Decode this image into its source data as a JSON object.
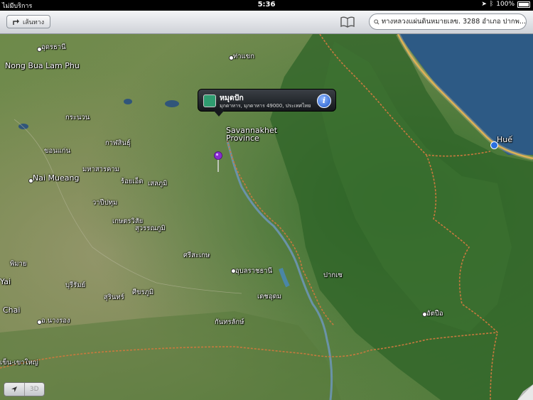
{
  "status": {
    "carrier": "ไม่มีบริการ",
    "time": "5:36",
    "battery": "100%"
  },
  "toolbar": {
    "directions_label": "เส้นทาง",
    "search_value": "ทางหลวงแผ่นดินหมายเลข. 3288 อำเภอ ปากพ..."
  },
  "callout": {
    "title": "หมุดปัก",
    "subtitle": "มุกดาหาร, มุกดาหาร 49000, ประเทศไทย",
    "info": "i"
  },
  "map_labels": [
    {
      "text": "อุดรธานี"
    },
    {
      "text": "Nong Bua Lam Phu"
    },
    {
      "text": "ท่าแขก"
    },
    {
      "text": "กระนวน"
    },
    {
      "text": "กาฬสินธุ์"
    },
    {
      "text": "ขอนแก่น"
    },
    {
      "text": "มหาสารคาม"
    },
    {
      "text": "ร้อยเอ็ด"
    },
    {
      "text": "เสลภูมิ"
    },
    {
      "text": "Nai Mueang"
    },
    {
      "text": "วาปีปทุม"
    },
    {
      "text": "เกษตรวิสัย"
    },
    {
      "text": "สุวรรณภูมิ"
    },
    {
      "text": "พิมาย"
    },
    {
      "text": "ศรีสะเกษ"
    },
    {
      "text": "อุบลราชธานี"
    },
    {
      "text": "ปากเซ"
    },
    {
      "text": "บุรีรัมย์"
    },
    {
      "text": "สุรินทร์"
    },
    {
      "text": "ศีขรภูมิ"
    },
    {
      "text": "เดชอุดม"
    },
    {
      "text": "Chai"
    },
    {
      "text": "อ.นางรอง"
    },
    {
      "text": "กันทรลักษ์"
    },
    {
      "text": "อัตปือ"
    },
    {
      "text": "Huế"
    },
    {
      "text": "Savannakhet\nProvince"
    },
    {
      "text": "Yai"
    },
    {
      "text": "เข็น-เขาใหญ่"
    }
  ],
  "controls": {
    "locate_icon": "location-arrow",
    "threed_label": "3D"
  },
  "colors": {
    "sea": "#2e5a86",
    "coast": "#e0a732",
    "border": "#c8793e",
    "pin": "#8a2bd1",
    "callout": "#1c1f24"
  }
}
